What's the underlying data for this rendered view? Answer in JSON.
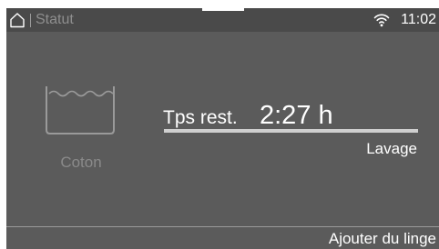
{
  "statusbar": {
    "title": "Statut",
    "time": "11:02",
    "icons": {
      "home": "home-icon",
      "wifi": "wifi-icon"
    }
  },
  "program": {
    "icon": "wash-tub-icon",
    "name": "Coton"
  },
  "remaining": {
    "label": "Tps rest.",
    "value": "2:27 h"
  },
  "phase": "Lavage",
  "footer": {
    "add_laundry_label": "Ajouter du linge"
  },
  "colors": {
    "screen_background": "#5b5b5b",
    "statusbar_background": "#4a4a4a",
    "text": "#ffffff",
    "dim_text": "#8a8a8a"
  }
}
